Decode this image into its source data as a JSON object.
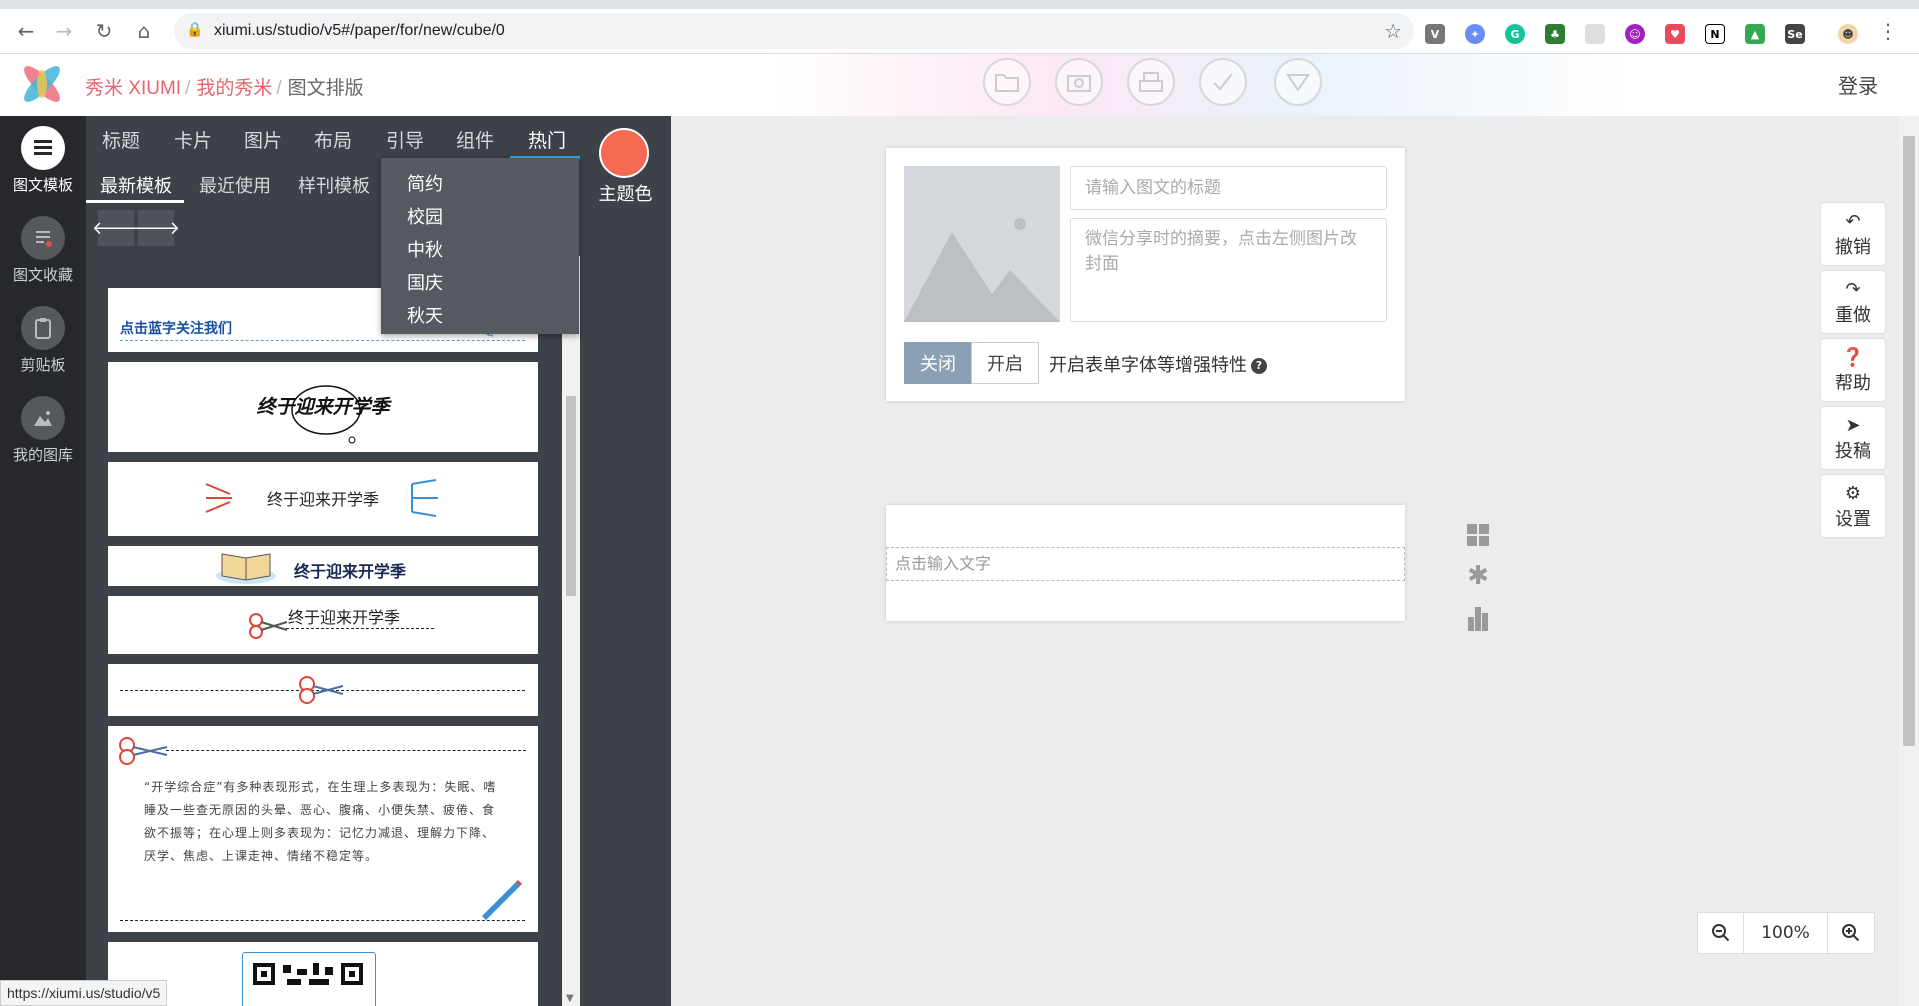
{
  "browser": {
    "url": "xiumi.us/studio/v5#/paper/for/new/cube/0"
  },
  "header": {
    "brand": "秀米 XIUMI",
    "crumb_mine": "我的秀米",
    "crumb_current": "图文排版",
    "crumb_sep": "/",
    "login": "登录",
    "toolbar_icons": [
      "folder-icon",
      "camera-icon",
      "printer-icon",
      "check-icon",
      "triangle-down-icon"
    ]
  },
  "rail": {
    "items": [
      {
        "label": "图文模板",
        "icon": "menu-icon"
      },
      {
        "label": "图文收藏",
        "icon": "favorites-icon"
      },
      {
        "label": "剪贴板",
        "icon": "clipboard-icon"
      },
      {
        "label": "我的图库",
        "icon": "gallery-icon"
      }
    ]
  },
  "panel": {
    "categories": [
      "标题",
      "卡片",
      "图片",
      "布局",
      "引导",
      "组件",
      "热门"
    ],
    "subtabs": [
      "最新模板",
      "最近使用",
      "样刊模板"
    ],
    "theme_label": "主题色",
    "theme_color": "#f46a53",
    "dropdown": [
      "简约",
      "校园",
      "中秋",
      "国庆",
      "秋天"
    ],
    "cards": {
      "follow": "点击蓝字关注我们",
      "school1": "终于迎来开学季",
      "school2": "终于迎来开学季",
      "school3": "终于迎来开学季",
      "school4": "终于迎来开学季",
      "article": "“开学综合症”有多种表现形式，在生理上多表现为：失眠、嗜睡及一些查无原因的头晕、恶心、腹痛、小便失禁、疲倦、食欲不振等；在心理上则多表现为：记忆力减退、理解力下降、厌学、焦虑、上课走神、情绪不稳定等。"
    }
  },
  "editor": {
    "title_placeholder": "请输入图文的标题",
    "summary_placeholder": "微信分享时的摘要，点击左侧图片改封面",
    "toggle_off": "关闭",
    "toggle_on": "开启",
    "toggle_label": "开启表单字体等增强特性",
    "help_glyph": "?",
    "body_placeholder": "点击输入文字"
  },
  "actions": [
    "撤销",
    "重做",
    "帮助",
    "投稿",
    "设置"
  ],
  "zoom": {
    "value": "100%"
  },
  "status_url": "https://xiumi.us/studio/v5"
}
